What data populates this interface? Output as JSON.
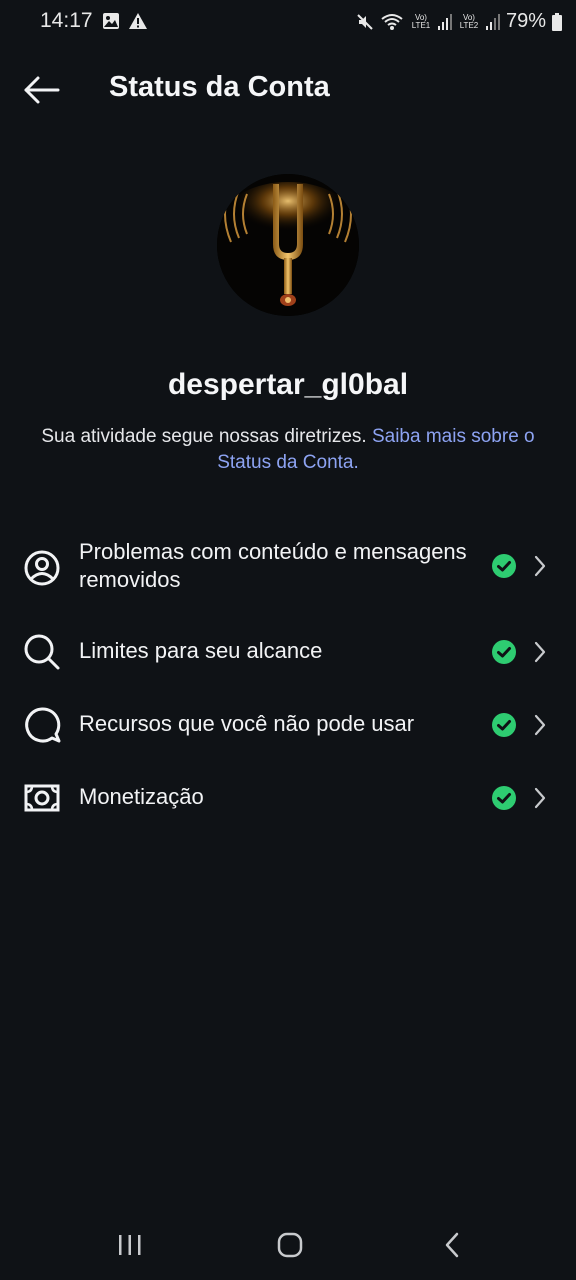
{
  "status_bar": {
    "time": "14:17",
    "left_icons": [
      "image-icon",
      "warning-icon"
    ],
    "right_icons": [
      "mute-icon",
      "wifi-icon",
      "signal-icon",
      "signal-icon",
      "battery-icon"
    ],
    "sim1_label": "Vo) LTE1",
    "sim2_label": "Vo) LTE2",
    "battery": "79%"
  },
  "header": {
    "title": "Status da Conta",
    "back_icon": "arrow-left-icon"
  },
  "profile": {
    "username": "despertar_gl0bal",
    "status_text": "Sua atividade segue nossas diretrizes. ",
    "status_link": "Saiba mais sobre o Status da Conta."
  },
  "items": [
    {
      "label": "Problemas com conteúdo e mensagens removidos",
      "icon": "user-circle-icon",
      "status": "ok"
    },
    {
      "label": "Limites para seu alcance",
      "icon": "search-icon",
      "status": "ok"
    },
    {
      "label": "Recursos que você não pode usar",
      "icon": "chat-bubble-icon",
      "status": "ok"
    },
    {
      "label": "Monetização",
      "icon": "money-icon",
      "status": "ok"
    }
  ],
  "colors": {
    "background": "#0f1216",
    "check_green": "#2ecc71",
    "link_blue": "#8da3f2"
  },
  "nav": [
    "recent-apps-icon",
    "home-icon",
    "back-icon"
  ]
}
